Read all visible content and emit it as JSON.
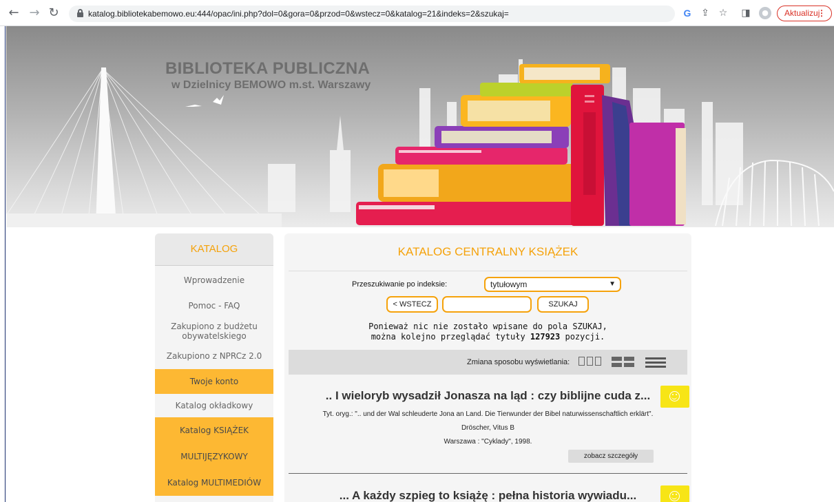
{
  "browser": {
    "url": "katalog.bibliotekabemowo.eu:444/opac/ini.php?dol=0&gora=0&przod=0&wstecz=0&katalog=21&indeks=2&szukaj=",
    "update_label": "Aktualizuj"
  },
  "banner": {
    "title": "BIBLIOTEKA PUBLICZNA",
    "subtitle": "w Dzielnicy BEMOWO m.st. Warszawy"
  },
  "sidebar": {
    "heading": "KATALOG",
    "items": [
      {
        "label": "Wprowadzenie"
      },
      {
        "label": "Pomoc - FAQ"
      },
      {
        "label": "Zakupiono z budżetu obywatelskiego"
      },
      {
        "label": "Zakupiono z NPRCz 2.0"
      },
      {
        "label": "Twoje konto"
      },
      {
        "label": "Katalog okładkowy"
      },
      {
        "label": "Katalog KSIĄŻEK"
      },
      {
        "label": "MULTIJĘZYKOWY"
      },
      {
        "label": "Katalog MULTIMEDIÓW"
      }
    ]
  },
  "main": {
    "title": "KATALOG CENTRALNY KSIĄŻEK",
    "index_label": "Przeszukiwanie po indeksie:",
    "index_value": "tytułowym",
    "back_label": "< WSTECZ",
    "search_value": "",
    "search_label": "SZUKAJ",
    "info_line1": "Ponieważ nic nie zostało wpisane do pola SZUKAJ,",
    "info_line2_prefix": "można kolejno przeglądać tytuły ",
    "info_count": "127923",
    "info_line2_suffix": " pozycji.",
    "view_label": "Zmiana sposobu wyświetlania:"
  },
  "results": [
    {
      "title": ".. I wieloryb wysadził Jonasza na ląd : czy biblijne cuda z...",
      "original_title": "Tyt. oryg.: \".. und der Wal schleuderte Jona an Land. Die Tierwunder der Bibel naturwissenschaftlich erklärt\".",
      "author": "Dröscher, Vitus B",
      "publication": "Warszawa : \"Cyklady\", 1998.",
      "details_label": "zobacz szczegóły"
    },
    {
      "title": "... A każdy szpieg to książę : pełna historia wywiadu..."
    }
  ],
  "colors": {
    "accent_orange": "#f5a20a",
    "sidebar_orange": "#fdb833",
    "smiley_yellow": "#f7e516"
  }
}
